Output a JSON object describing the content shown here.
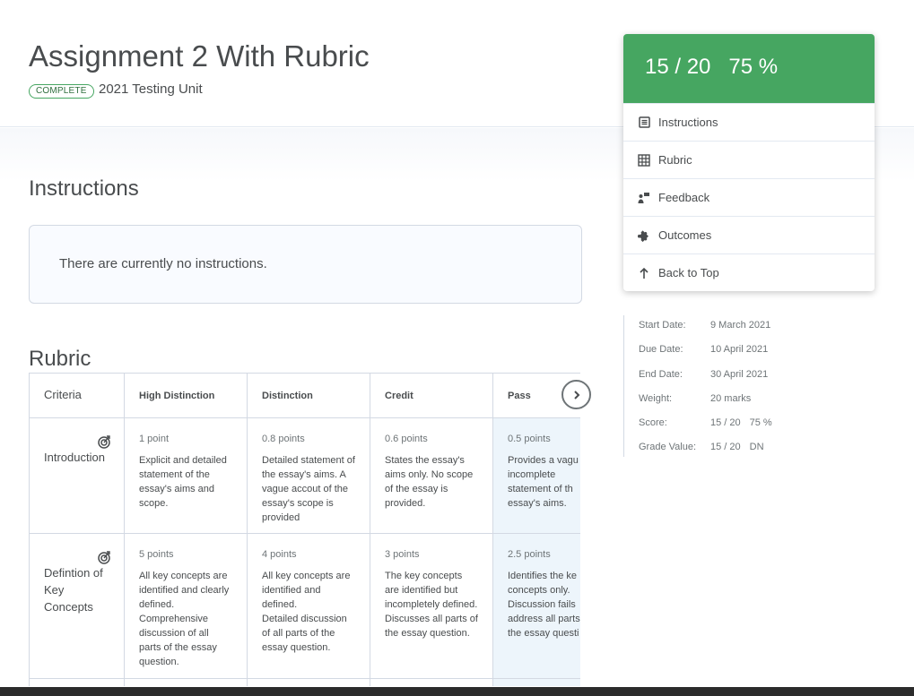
{
  "header": {
    "title": "Assignment 2 With Rubric",
    "badge": "COMPLETE",
    "unit": "2021 Testing Unit"
  },
  "instructions": {
    "heading": "Instructions",
    "text": "There are currently no instructions."
  },
  "rubric": {
    "heading": "Rubric",
    "columns": [
      "Criteria",
      "High Distinction",
      "Distinction",
      "Credit",
      "Pass"
    ],
    "rows": [
      {
        "criterion": "Introduction",
        "cells": [
          {
            "points": "1 point",
            "desc": "Explicit and detailed statement of the essay's aims and scope."
          },
          {
            "points": "0.8 points",
            "desc": "Detailed statement of the essay's aims. A vague accout of the essay's scope is provided"
          },
          {
            "points": "0.6 points",
            "desc": "States the essay's aims only. No scope of the essay is provided."
          },
          {
            "points": "0.5 points",
            "desc": "Provides a vagu incomplete statement of th essay's aims."
          }
        ]
      },
      {
        "criterion": "Defintion of Key Concepts",
        "cells": [
          {
            "points": "5 points",
            "desc": "All key concepts are identified and clearly defined. Comprehensive discussion of all parts of the essay question."
          },
          {
            "points": "4 points",
            "desc": "All key concepts are identified and defined.\nDetailed discussion of all parts of the essay question."
          },
          {
            "points": "3 points",
            "desc": "The key concepts are identified but incompletely defined.\nDiscusses all parts of the essay question."
          },
          {
            "points": "2.5 points",
            "desc": "Identifies the ke concepts only. Discussion fails address all parts the essay questi"
          }
        ]
      }
    ]
  },
  "grade": {
    "score": "15 / 20",
    "percent": "75 %",
    "color": "#46a661"
  },
  "nav": [
    {
      "label": "Instructions",
      "icon": "instructions-icon"
    },
    {
      "label": "Rubric",
      "icon": "grid-icon"
    },
    {
      "label": "Feedback",
      "icon": "feedback-icon"
    },
    {
      "label": "Outcomes",
      "icon": "puzzle-icon"
    },
    {
      "label": "Back to Top",
      "icon": "arrow-up-icon"
    }
  ],
  "details": {
    "start_label": "Start Date:",
    "start_value": "9 March 2021",
    "due_label": "Due Date:",
    "due_value": "10 April 2021",
    "end_label": "End Date:",
    "end_value": "30 April 2021",
    "weight_label": "Weight:",
    "weight_value": "20 marks",
    "score_label": "Score:",
    "score_value": "15 / 20",
    "score_percent": "75 %",
    "grade_label": "Grade Value:",
    "grade_value": "15 / 20",
    "grade_letter": "DN"
  }
}
